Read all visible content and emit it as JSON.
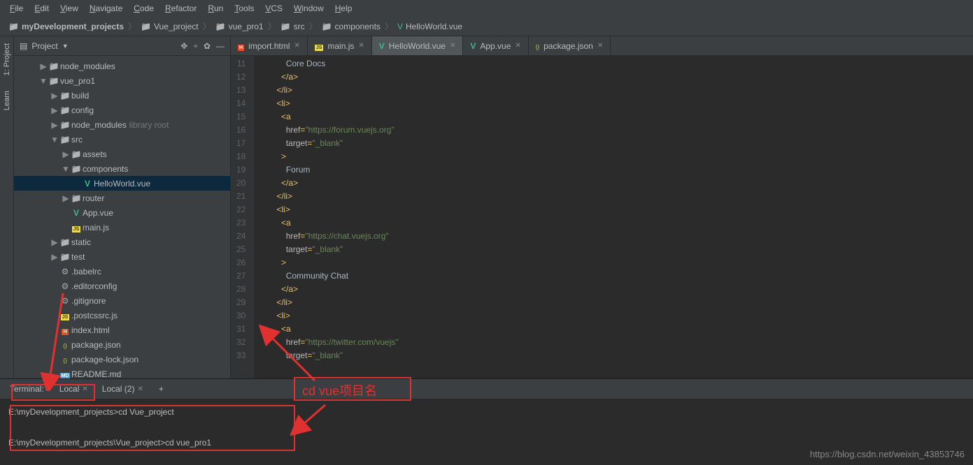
{
  "menubar": [
    "File",
    "Edit",
    "View",
    "Navigate",
    "Code",
    "Refactor",
    "Run",
    "Tools",
    "VCS",
    "Window",
    "Help"
  ],
  "breadcrumb": [
    {
      "label": "myDevelopment_projects",
      "icon": "folder"
    },
    {
      "label": "Vue_project",
      "icon": "folder"
    },
    {
      "label": "vue_pro1",
      "icon": "folder"
    },
    {
      "label": "src",
      "icon": "folder"
    },
    {
      "label": "components",
      "icon": "folder"
    },
    {
      "label": "HelloWorld.vue",
      "icon": "vue"
    }
  ],
  "sidebarTabs": [
    "1: Project",
    "Learn"
  ],
  "projectPanel": {
    "title": "Project"
  },
  "tree": [
    {
      "indent": 1,
      "arrow": "▶",
      "icon": "folder",
      "label": "node_modules"
    },
    {
      "indent": 1,
      "arrow": "▼",
      "icon": "folder",
      "label": "vue_pro1"
    },
    {
      "indent": 2,
      "arrow": "▶",
      "icon": "folder",
      "label": "build"
    },
    {
      "indent": 2,
      "arrow": "▶",
      "icon": "folder",
      "label": "config"
    },
    {
      "indent": 2,
      "arrow": "▶",
      "icon": "folder",
      "label": "node_modules",
      "extra": "library root"
    },
    {
      "indent": 2,
      "arrow": "▼",
      "icon": "folder",
      "label": "src"
    },
    {
      "indent": 3,
      "arrow": "▶",
      "icon": "folder",
      "label": "assets"
    },
    {
      "indent": 3,
      "arrow": "▼",
      "icon": "folder",
      "label": "components"
    },
    {
      "indent": 4,
      "arrow": "",
      "icon": "vue",
      "label": "HelloWorld.vue",
      "selected": true
    },
    {
      "indent": 3,
      "arrow": "▶",
      "icon": "folder",
      "label": "router"
    },
    {
      "indent": 3,
      "arrow": "",
      "icon": "vue",
      "label": "App.vue"
    },
    {
      "indent": 3,
      "arrow": "",
      "icon": "js",
      "label": "main.js"
    },
    {
      "indent": 2,
      "arrow": "▶",
      "icon": "folder",
      "label": "static"
    },
    {
      "indent": 2,
      "arrow": "▶",
      "icon": "folder",
      "label": "test"
    },
    {
      "indent": 2,
      "arrow": "",
      "icon": "gear",
      "label": ".babelrc"
    },
    {
      "indent": 2,
      "arrow": "",
      "icon": "gear",
      "label": ".editorconfig"
    },
    {
      "indent": 2,
      "arrow": "",
      "icon": "gear",
      "label": ".gitignore"
    },
    {
      "indent": 2,
      "arrow": "",
      "icon": "js",
      "label": ".postcssrc.js"
    },
    {
      "indent": 2,
      "arrow": "",
      "icon": "html",
      "label": "index.html"
    },
    {
      "indent": 2,
      "arrow": "",
      "icon": "json",
      "label": "package.json"
    },
    {
      "indent": 2,
      "arrow": "",
      "icon": "json",
      "label": "package-lock.json"
    },
    {
      "indent": 2,
      "arrow": "",
      "icon": "md",
      "label": "README.md"
    }
  ],
  "editorTabs": [
    {
      "label": "import.html",
      "icon": "html"
    },
    {
      "label": "main.js",
      "icon": "js"
    },
    {
      "label": "HelloWorld.vue",
      "icon": "vue",
      "active": true
    },
    {
      "label": "App.vue",
      "icon": "vue"
    },
    {
      "label": "package.json",
      "icon": "json"
    }
  ],
  "code": {
    "startLine": 11,
    "lines": [
      {
        "n": 11,
        "html": "          Core Docs"
      },
      {
        "n": 12,
        "html": "        <span class='tag'>&lt;/a&gt;</span>"
      },
      {
        "n": 13,
        "html": "      <span class='tag'>&lt;/li&gt;</span>"
      },
      {
        "n": 14,
        "html": "      <span class='tag'>&lt;li&gt;</span>"
      },
      {
        "n": 15,
        "html": "        <span class='tag'>&lt;a</span>"
      },
      {
        "n": 16,
        "html": "          <span class='attr'>href</span><span class='tag'>=</span><span class='str'>\"https://forum.vuejs.org\"</span>"
      },
      {
        "n": 17,
        "html": "          <span class='attr'>target</span><span class='tag'>=</span><span class='str'>\"_blank\"</span>"
      },
      {
        "n": 18,
        "html": "        <span class='tag'>&gt;</span>"
      },
      {
        "n": 19,
        "html": "          Forum"
      },
      {
        "n": 20,
        "html": "        <span class='tag'>&lt;/a&gt;</span>"
      },
      {
        "n": 21,
        "html": "      <span class='tag'>&lt;/li&gt;</span>"
      },
      {
        "n": 22,
        "html": "      <span class='tag'>&lt;li&gt;</span>"
      },
      {
        "n": 23,
        "html": "        <span class='tag'>&lt;a</span>"
      },
      {
        "n": 24,
        "html": "          <span class='attr'>href</span><span class='tag'>=</span><span class='str'>\"https://chat.vuejs.org\"</span>"
      },
      {
        "n": 25,
        "html": "          <span class='attr'>target</span><span class='tag'>=</span><span class='str'>\"_blank\"</span>"
      },
      {
        "n": 26,
        "html": "        <span class='tag'>&gt;</span>"
      },
      {
        "n": 27,
        "html": "          Community Chat"
      },
      {
        "n": 28,
        "html": "        <span class='tag'>&lt;/a&gt;</span>"
      },
      {
        "n": 29,
        "html": "      <span class='tag'>&lt;/li&gt;</span>"
      },
      {
        "n": 30,
        "html": "      <span class='tag'>&lt;li&gt;</span>"
      },
      {
        "n": 31,
        "html": "        <span class='tag'>&lt;a</span>"
      },
      {
        "n": 32,
        "html": "          <span class='attr'>href</span><span class='tag'>=</span><span class='str'>\"https://twitter.com/vuejs\"</span>"
      },
      {
        "n": 33,
        "html": "          <span class='attr'>target</span><span class='tag'>=</span><span class='str'>\"_blank\"</span>"
      }
    ]
  },
  "terminal": {
    "title": "Terminal:",
    "tabs": [
      {
        "label": "Local"
      },
      {
        "label": "Local (2)"
      }
    ],
    "lines": [
      "E:\\myDevelopment_projects>cd Vue_project",
      "",
      "E:\\myDevelopment_projects\\Vue_project>cd vue_pro1"
    ]
  },
  "annotations": {
    "cdText": "cd vue项目名"
  },
  "watermark": "https://blog.csdn.net/weixin_43853746"
}
